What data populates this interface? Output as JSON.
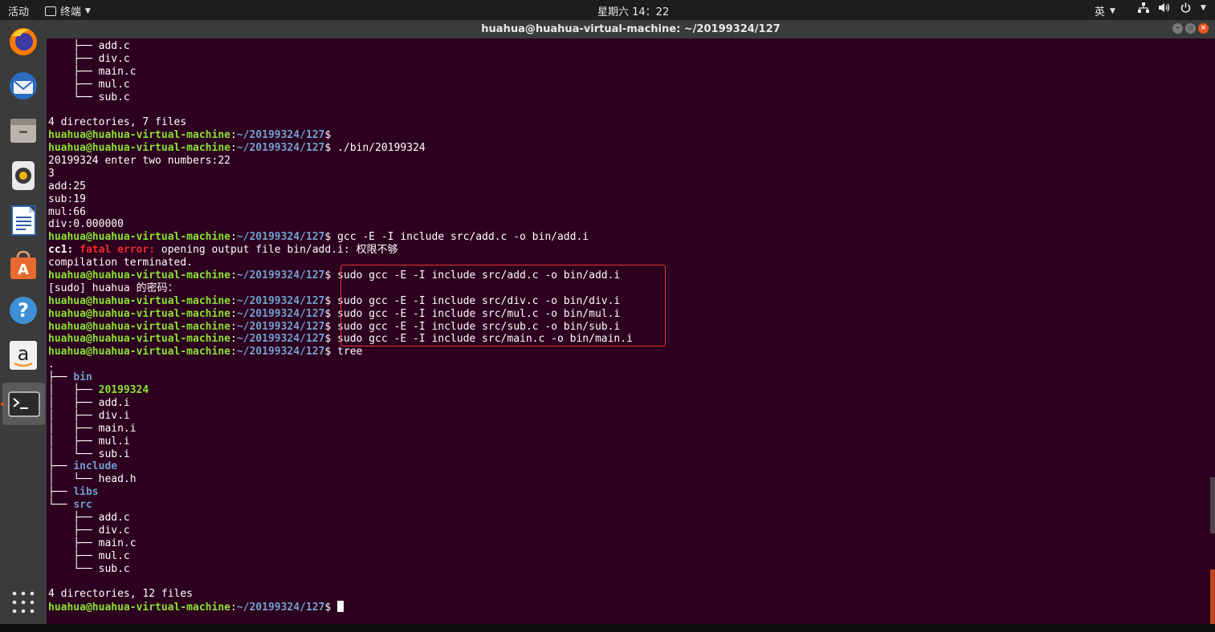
{
  "topbar": {
    "activities": "活动",
    "app_menu": "终端",
    "clock": "星期六 14：22",
    "input_method": "英",
    "icons": [
      "network-icon",
      "volume-icon",
      "power-icon",
      "chevron-down-icon"
    ]
  },
  "window": {
    "title": "huahua@huahua-virtual-machine: ~/20199324/127"
  },
  "dock": {
    "items": [
      "firefox-icon",
      "thunderbird-icon",
      "files-icon",
      "rhythmbox-icon",
      "writer-icon",
      "software-icon",
      "help-icon",
      "amazon-icon",
      "terminal-icon",
      "show-apps-icon"
    ]
  },
  "prompt": {
    "user": "huahua@huahua-virtual-machine",
    "path": "~/20199324/127"
  },
  "terminal": {
    "lines": [
      {
        "type": "tree",
        "branch": "    ├── ",
        "name": "add.c"
      },
      {
        "type": "tree",
        "branch": "    ├── ",
        "name": "div.c"
      },
      {
        "type": "tree",
        "branch": "    ├── ",
        "name": "main.c"
      },
      {
        "type": "tree",
        "branch": "    ├── ",
        "name": "mul.c"
      },
      {
        "type": "tree",
        "branch": "    └── ",
        "name": "sub.c"
      },
      {
        "type": "text",
        "text": ""
      },
      {
        "type": "text",
        "text": "4 directories, 7 files"
      },
      {
        "type": "prompt",
        "cmd": ""
      },
      {
        "type": "prompt",
        "cmd": "./bin/20199324"
      },
      {
        "type": "text",
        "text": "20199324 enter two numbers:22"
      },
      {
        "type": "text",
        "text": "3"
      },
      {
        "type": "text",
        "text": "add:25"
      },
      {
        "type": "text",
        "text": "sub:19"
      },
      {
        "type": "text",
        "text": "mul:66"
      },
      {
        "type": "text",
        "text": "div:0.000000"
      },
      {
        "type": "prompt",
        "cmd": "gcc -E -I include src/add.c -o bin/add.i"
      },
      {
        "type": "error",
        "prefix": "cc1: ",
        "label": "fatal error: ",
        "text": "opening output file bin/add.i: 权限不够"
      },
      {
        "type": "text",
        "text": "compilation terminated."
      },
      {
        "type": "prompt",
        "cmd": "sudo gcc -E -I include src/add.c -o bin/add.i"
      },
      {
        "type": "text",
        "text": "[sudo] huahua 的密码："
      },
      {
        "type": "prompt",
        "cmd": "sudo gcc -E -I include src/div.c -o bin/div.i"
      },
      {
        "type": "prompt",
        "cmd": "sudo gcc -E -I include src/mul.c -o bin/mul.i"
      },
      {
        "type": "prompt",
        "cmd": "sudo gcc -E -I include src/sub.c -o bin/sub.i"
      },
      {
        "type": "prompt",
        "cmd": "sudo gcc -E -I include src/main.c -o bin/main.i"
      },
      {
        "type": "prompt",
        "cmd": "tree"
      },
      {
        "type": "text",
        "text": "."
      },
      {
        "type": "treedir",
        "branch": "├── ",
        "name": "bin"
      },
      {
        "type": "treeexe",
        "branch": "│   ├── ",
        "name": "20199324"
      },
      {
        "type": "tree",
        "branch": "│   ├── ",
        "name": "add.i"
      },
      {
        "type": "tree",
        "branch": "│   ├── ",
        "name": "div.i"
      },
      {
        "type": "tree",
        "branch": "│   ├── ",
        "name": "main.i"
      },
      {
        "type": "tree",
        "branch": "│   ├── ",
        "name": "mul.i"
      },
      {
        "type": "tree",
        "branch": "│   └── ",
        "name": "sub.i"
      },
      {
        "type": "treedir",
        "branch": "├── ",
        "name": "include"
      },
      {
        "type": "tree",
        "branch": "│   └── ",
        "name": "head.h"
      },
      {
        "type": "treedir",
        "branch": "├── ",
        "name": "libs"
      },
      {
        "type": "treedir",
        "branch": "└── ",
        "name": "src"
      },
      {
        "type": "tree",
        "branch": "    ├── ",
        "name": "add.c"
      },
      {
        "type": "tree",
        "branch": "    ├── ",
        "name": "div.c"
      },
      {
        "type": "tree",
        "branch": "    ├── ",
        "name": "main.c"
      },
      {
        "type": "tree",
        "branch": "    ├── ",
        "name": "mul.c"
      },
      {
        "type": "tree",
        "branch": "    └── ",
        "name": "sub.c"
      },
      {
        "type": "text",
        "text": ""
      },
      {
        "type": "text",
        "text": "4 directories, 12 files"
      },
      {
        "type": "promptcursor",
        "cmd": ""
      }
    ]
  },
  "colors": {
    "terminal_bg": "#2c001e",
    "prompt_green": "#8ae234",
    "path_blue": "#729fcf",
    "error_red": "#ef2929",
    "highlight_box": "#e53935",
    "ubuntu_orange": "#e95420"
  }
}
